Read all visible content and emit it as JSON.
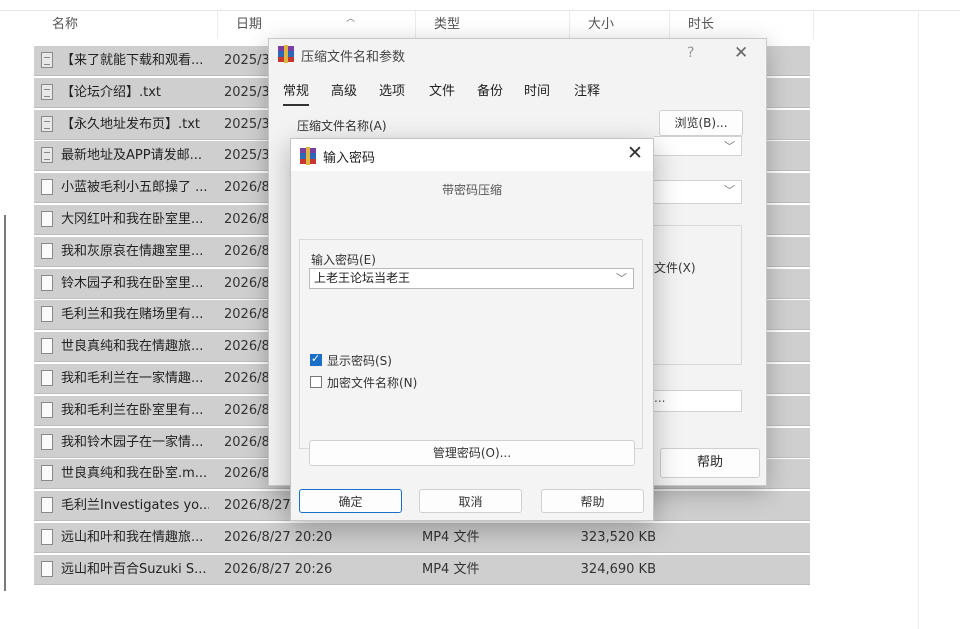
{
  "explorer": {
    "columns": [
      "名称",
      "日期",
      "类型",
      "大小",
      "时长"
    ],
    "rows": [
      {
        "name": "【来了就能下载和观看...",
        "date": "2025/3",
        "type": "",
        "size": "",
        "icon": "text-file-icon"
      },
      {
        "name": "【论坛介绍】.txt",
        "date": "2025/3",
        "type": "",
        "size": "",
        "icon": "text-file-icon"
      },
      {
        "name": "【永久地址发布页】.txt",
        "date": "2025/3",
        "type": "",
        "size": "",
        "icon": "text-file-icon"
      },
      {
        "name": "最新地址及APP请发邮...",
        "date": "2025/3",
        "type": "",
        "size": "",
        "icon": "text-file-icon"
      },
      {
        "name": "小蓝被毛利小五郎操了 ...",
        "date": "2026/8",
        "type": "",
        "size": "",
        "icon": "video-file-icon"
      },
      {
        "name": "大冈红叶和我在卧室里...",
        "date": "2026/8",
        "type": "",
        "size": "",
        "icon": "video-file-icon"
      },
      {
        "name": "我和灰原哀在情趣室里...",
        "date": "2026/8",
        "type": "",
        "size": "",
        "icon": "video-file-icon"
      },
      {
        "name": "铃木园子和我在卧室里...",
        "date": "2026/8",
        "type": "",
        "size": "",
        "icon": "video-file-icon"
      },
      {
        "name": "毛利兰和我在赌场里有...",
        "date": "2026/8",
        "type": "",
        "size": "",
        "icon": "video-file-icon"
      },
      {
        "name": "世良真纯和我在情趣旅...",
        "date": "2026/8",
        "type": "",
        "size": "",
        "icon": "video-file-icon"
      },
      {
        "name": "我和毛利兰在一家情趣...",
        "date": "2026/8",
        "type": "",
        "size": "",
        "icon": "video-file-icon"
      },
      {
        "name": "我和毛利兰在卧室里有...",
        "date": "2026/8",
        "type": "",
        "size": "",
        "icon": "video-file-icon"
      },
      {
        "name": "我和铃木园子在一家情...",
        "date": "2026/8",
        "type": "",
        "size": "",
        "icon": "video-file-icon"
      },
      {
        "name": "世良真纯和我在卧室.m...",
        "date": "2026/8",
        "type": "",
        "size": "",
        "icon": "video-file-icon"
      },
      {
        "name": "毛利兰Investigates yo...",
        "date": "2026/8/27",
        "type": "",
        "size": "",
        "icon": "video-file-icon"
      },
      {
        "name": "远山和叶和我在情趣旅...",
        "date": "2026/8/27 20:20",
        "type": "MP4 文件",
        "size": "323,520 KB",
        "icon": "video-file-icon"
      },
      {
        "name": "远山和叶百合Suzuki S...",
        "date": "2026/8/27 20:26",
        "type": "MP4 文件",
        "size": "324,690 KB",
        "icon": "video-file-icon"
      }
    ]
  },
  "params_dialog": {
    "title": "压缩文件名和参数",
    "help_glyph": "?",
    "close_glyph": "✕",
    "tabs": [
      "常规",
      "高级",
      "选项",
      "文件",
      "备份",
      "时间",
      "注释"
    ],
    "active_tab": "常规",
    "archive_name_label": "压缩文件名称(A)",
    "browse_button": "浏览(B)...",
    "option_partial_text": "文件(X)",
    "field_dots": "...",
    "help_button": "帮助"
  },
  "password_dialog": {
    "title": "输入密码",
    "close_glyph": "✕",
    "subtitle": "带密码压缩",
    "enter_password_label": "输入密码(E)",
    "password_value": "上老王论坛当老王",
    "show_password": {
      "label": "显示密码(S)",
      "checked": true
    },
    "encrypt_names": {
      "label": "加密文件名称(N)",
      "checked": false
    },
    "manage_button": "管理密码(O)...",
    "ok_button": "确定",
    "cancel_button": "取消",
    "help_button": "帮助"
  },
  "colors": {
    "accent": "#1a6fc9",
    "row_selected": "#cfcfcf"
  }
}
